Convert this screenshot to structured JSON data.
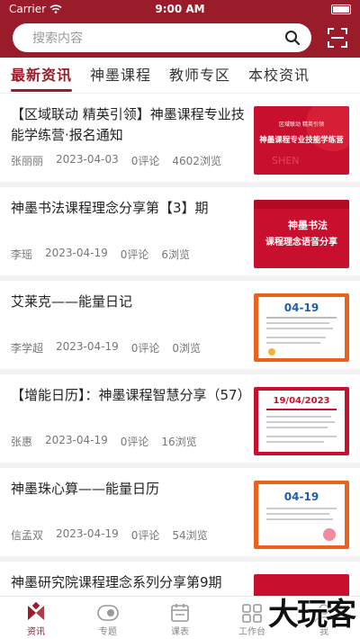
{
  "status": {
    "carrier": "Carrier",
    "time": "9:00 AM"
  },
  "search": {
    "placeholder": "搜索内容"
  },
  "tabs": [
    {
      "label": "最新资讯",
      "active": true
    },
    {
      "label": "神墨课程"
    },
    {
      "label": "教师专区"
    },
    {
      "label": "本校资讯"
    }
  ],
  "articles": [
    {
      "title": "【区域联动 精英引领】神墨课程专业技能学练营·报名通知",
      "author": "张丽丽",
      "date": "2023-04-03",
      "comments": "0评论",
      "views": "4602浏览",
      "thumb_text": "区域联动 精英引领 / 神墨课程专业技能学练营"
    },
    {
      "title": "神墨书法课程理念分享第【3】期",
      "author": "李瑶",
      "date": "2023-04-19",
      "comments": "0评论",
      "views": "6浏览",
      "thumb_text": "神墨书法 / 课程理念语音分享"
    },
    {
      "title": "艾莱克——能量日记",
      "author": "李学超",
      "date": "2023-04-19",
      "comments": "0评论",
      "views": "0浏览",
      "thumb_text": "04-19"
    },
    {
      "title": "【增能日历】：神墨课程智慧分享（57）",
      "author": "张惠",
      "date": "2023-04-19",
      "comments": "0评论",
      "views": "16浏览",
      "thumb_text": "19/04/2023"
    },
    {
      "title": "神墨珠心算——能量日历",
      "author": "信孟双",
      "date": "2023-04-19",
      "comments": "0评论",
      "views": "54浏览",
      "thumb_text": "04-19"
    },
    {
      "title": "神墨研究院课程理念系列分享第9期",
      "author": "",
      "date": "",
      "comments": "",
      "views": "",
      "thumb_text": ""
    }
  ],
  "tabbar": [
    {
      "label": "资讯",
      "icon": "news-icon",
      "active": true
    },
    {
      "label": "专题",
      "icon": "topic-icon"
    },
    {
      "label": "课表",
      "icon": "calendar-icon"
    },
    {
      "label": "工作台",
      "icon": "workbench-icon"
    },
    {
      "label": "我",
      "icon": "user-icon"
    }
  ],
  "watermark": "大玩客",
  "colors": {
    "brand": "#9a1b2a",
    "thumb_red": "#c8102e",
    "thumb_orange": "#e8641e"
  }
}
